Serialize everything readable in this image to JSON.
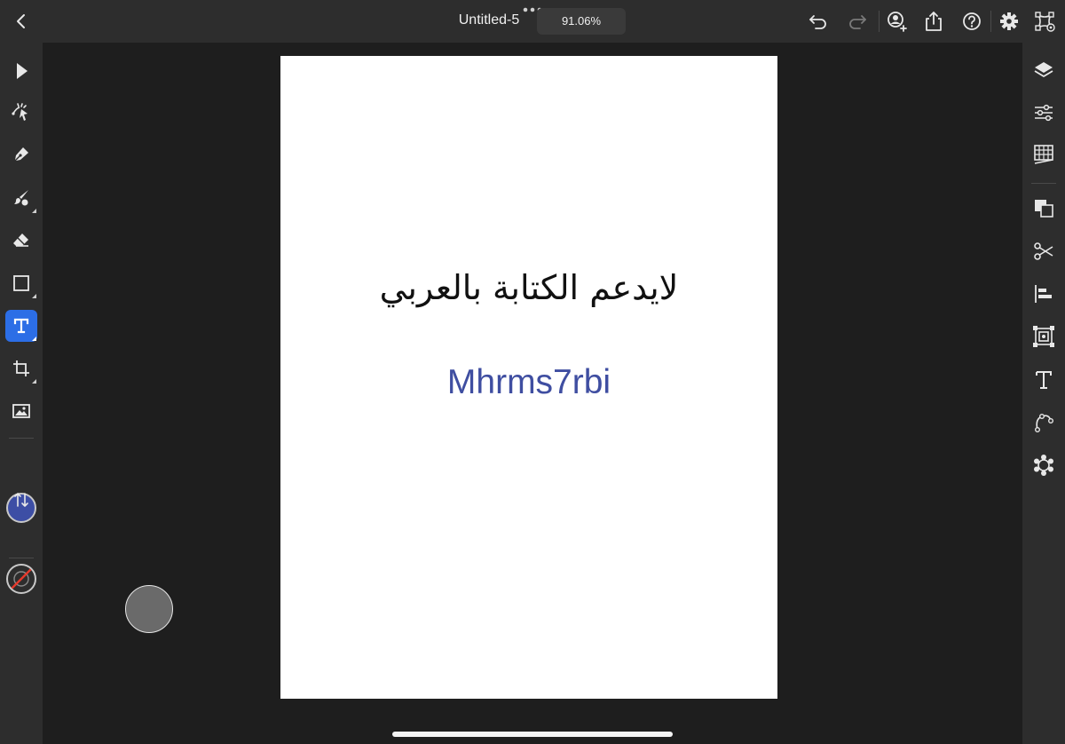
{
  "document": {
    "title": "Untitled-5",
    "zoom": "91.06%"
  },
  "canvas": {
    "arabic_text": "لايدعم الكتابة بالعربي",
    "latin_text": "Mhrms7rbi",
    "latin_text_color": "#3f4ea1"
  },
  "colors": {
    "accent": "#2c6ee6",
    "fill": "#3d4ea5",
    "stroke": "none"
  },
  "top_bar_icons": [
    "back-icon",
    "more-dots-icon",
    "undo-icon",
    "redo-icon",
    "invite-user-icon",
    "share-icon",
    "help-icon",
    "settings-gear-icon",
    "path-handles-icon"
  ],
  "left_tools": [
    "selection",
    "direct-selection",
    "pen",
    "brush",
    "eraser",
    "shape",
    "text",
    "transform",
    "image"
  ],
  "active_tool": "text",
  "right_panels": [
    "layers",
    "properties",
    "grid",
    "arrange",
    "scissors",
    "align",
    "repeat-grid",
    "type",
    "path",
    "component"
  ]
}
